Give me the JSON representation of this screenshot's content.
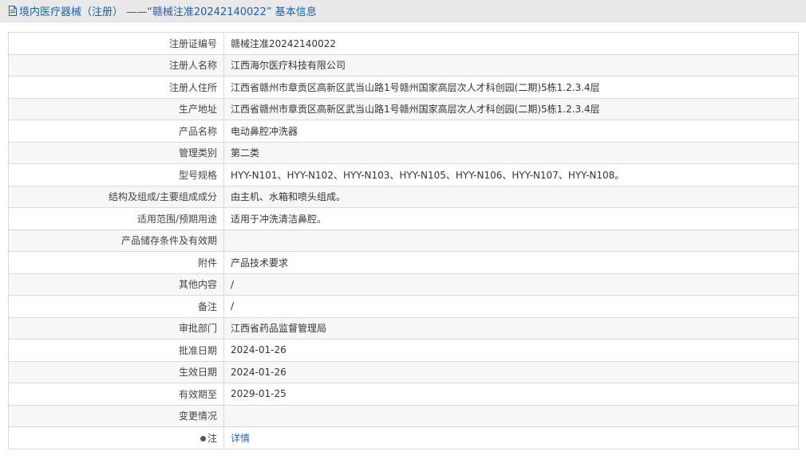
{
  "header": {
    "title": "境内医疗器械（注册） ——“赣械注准20242140022” 基本信息"
  },
  "rows": [
    {
      "label": "注册证编号",
      "value": "赣械注准20242140022"
    },
    {
      "label": "注册人名称",
      "value": "江西海尔医疗科技有限公司"
    },
    {
      "label": "注册人住所",
      "value": "江西省赣州市章贡区高新区武当山路1号赣州国家高层次人才科创园(二期)5栋1.2.3.4层"
    },
    {
      "label": "生产地址",
      "value": "江西省赣州市章贡区高新区武当山路1号赣州国家高层次人才科创园(二期)5栋1.2.3.4层"
    },
    {
      "label": "产品名称",
      "value": "电动鼻腔冲洗器"
    },
    {
      "label": "管理类别",
      "value": "第二类"
    },
    {
      "label": "型号规格",
      "value": "HYY-N101、HYY-N102、HYY-N103、HYY-N105、HYY-N106、HYY-N107、HYY-N108。"
    },
    {
      "label": "结构及组成/主要组成成分",
      "value": "由主机、水箱和喷头组成。"
    },
    {
      "label": "适用范围/预期用途",
      "value": "适用于冲洗清洁鼻腔。"
    },
    {
      "label": "产品储存条件及有效期",
      "value": ""
    },
    {
      "label": "附件",
      "value": "产品技术要求"
    },
    {
      "label": "其他内容",
      "value": "/"
    },
    {
      "label": "备注",
      "value": "/"
    },
    {
      "label": "审批部门",
      "value": "江西省药品监督管理局"
    },
    {
      "label": "批准日期",
      "value": "2024-01-26"
    },
    {
      "label": "生效日期",
      "value": "2024-01-26"
    },
    {
      "label": "有效期至",
      "value": "2029-01-25"
    },
    {
      "label": "变更情况",
      "value": ""
    }
  ],
  "note": {
    "label": "注",
    "link": "详情"
  }
}
